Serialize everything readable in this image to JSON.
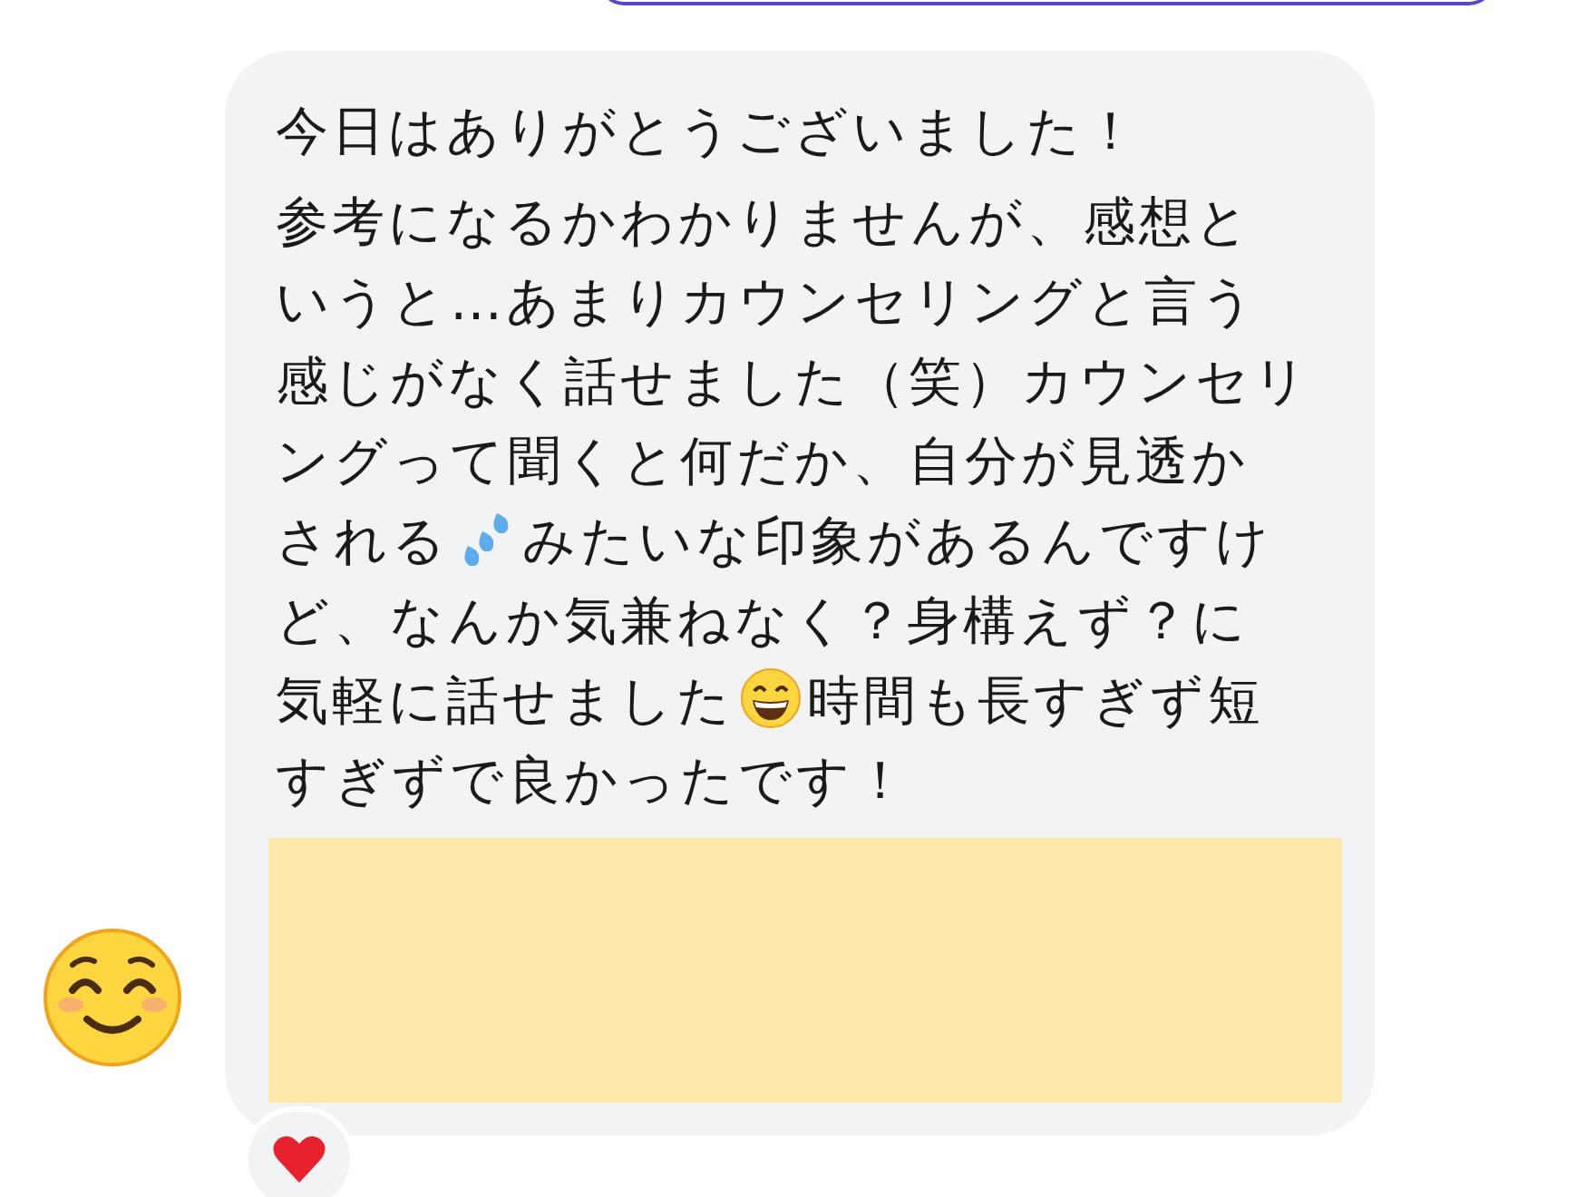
{
  "message": {
    "lines": [
      [
        {
          "kind": "text",
          "text": "今日はありがとうございました！"
        }
      ],
      [
        {
          "kind": "text",
          "text": "参考になるかわかりませんが、感想と"
        }
      ],
      [
        {
          "kind": "text",
          "text": "いうと…あまりカウンセリングと言う"
        }
      ],
      [
        {
          "kind": "text",
          "text": "感じがなく話せました（笑）カウンセリ"
        }
      ],
      [
        {
          "kind": "text",
          "text": "ングって聞くと何だか、自分が見透か"
        }
      ],
      [
        {
          "kind": "text",
          "text": "される"
        },
        {
          "kind": "sweat"
        },
        {
          "kind": "text",
          "text": "みたいな印象があるんですけ"
        }
      ],
      [
        {
          "kind": "text",
          "text": "ど、なんか気兼ねなく？身構えず？に"
        }
      ],
      [
        {
          "kind": "text",
          "text": "気軽に話せました"
        },
        {
          "kind": "grin"
        },
        {
          "kind": "text",
          "text": "時間も長すぎず短"
        }
      ],
      [
        {
          "kind": "text",
          "text": "すぎずで良かったです！"
        }
      ]
    ]
  },
  "attachment": {
    "kind": "redacted"
  },
  "reaction": {
    "kind": "heart"
  }
}
